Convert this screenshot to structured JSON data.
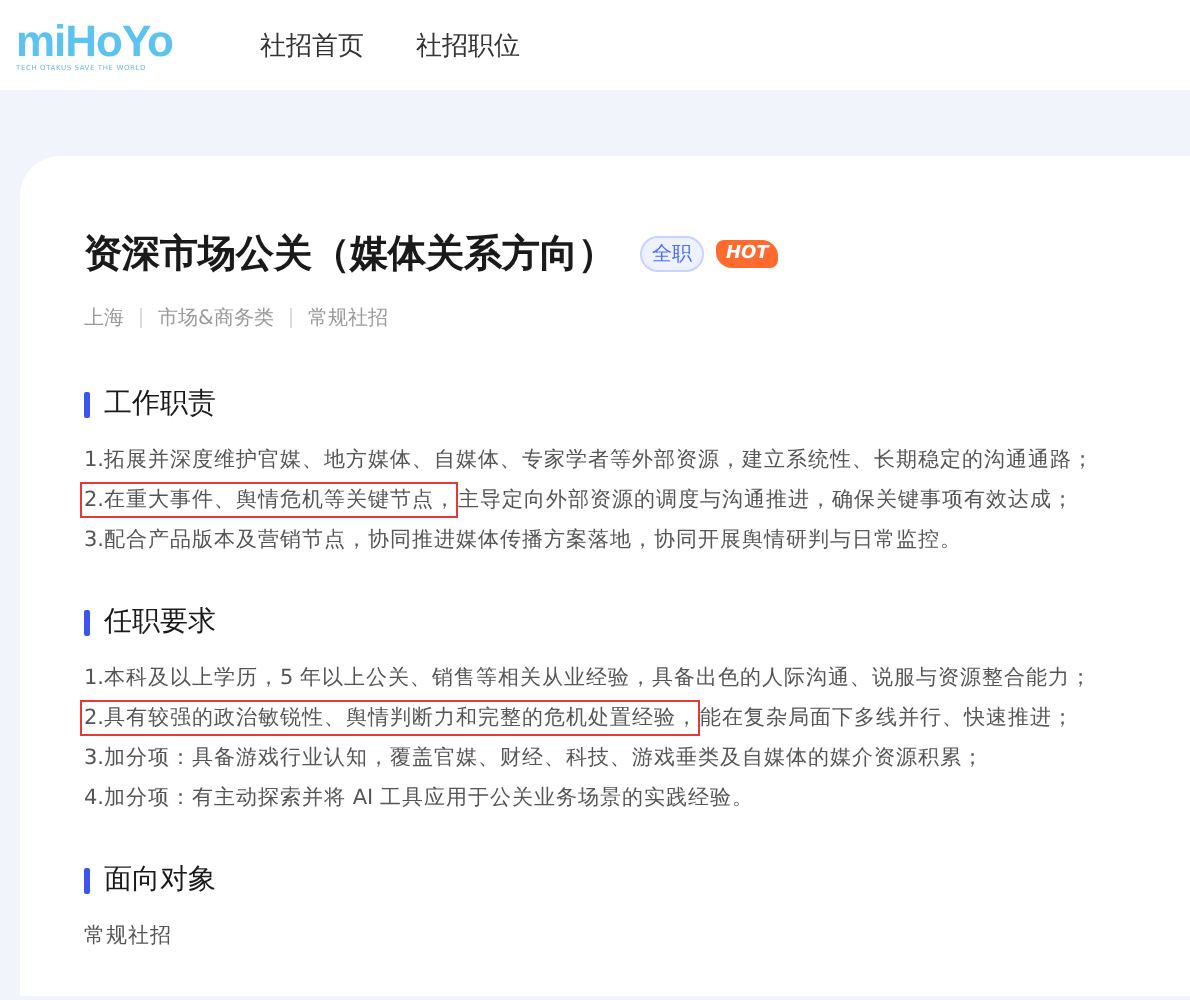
{
  "header": {
    "logo": {
      "wordmark": "miHoYo",
      "tagline": "TECH OTAKUS SAVE THE WORLD"
    },
    "nav": [
      {
        "label": "社招首页",
        "selected": false
      },
      {
        "label": "社招职位",
        "selected": false
      }
    ]
  },
  "job": {
    "title": "资深市场公关（媒体关系方向）",
    "tags": [
      {
        "label": "全职",
        "kind": "type"
      },
      {
        "label": "HOT",
        "kind": "hot"
      }
    ],
    "meta": [
      "上海",
      "市场&商务类",
      "常规社招"
    ]
  },
  "sections": [
    {
      "heading": "工作职责",
      "lines": [
        [
          {
            "text": "1.拓展并深度维护官媒、地方媒体、自媒体、专家学者等外部资源，建立系统性、长期稳定的沟通通路；",
            "highlighted": false
          }
        ],
        [
          {
            "text": "2.在重大事件、舆情危机等关键节点，",
            "highlighted": true
          },
          {
            "text": "主导定向外部资源的调度与沟通推进，确保关键事项有效达成；",
            "highlighted": false
          }
        ],
        [
          {
            "text": "3.配合产品版本及营销节点，协同推进媒体传播方案落地，协同开展舆情研判与日常监控。",
            "highlighted": false
          }
        ]
      ]
    },
    {
      "heading": "任职要求",
      "lines": [
        [
          {
            "text": "1.本科及以上学历，5 年以上公关、销售等相关从业经验，具备出色的人际沟通、说服与资源整合能力；",
            "highlighted": false
          }
        ],
        [
          {
            "text": "2.具有较强的政治敏锐性、舆情判断力和完整的危机处置经验，",
            "highlighted": true
          },
          {
            "text": "能在复杂局面下多线并行、快速推进；",
            "highlighted": false
          }
        ],
        [
          {
            "text": "3.加分项：具备游戏行业认知，覆盖官媒、财经、科技、游戏垂类及自媒体的媒介资源积累；",
            "highlighted": false
          }
        ],
        [
          {
            "text": "4.加分项：有主动探索并将 AI 工具应用于公关业务场景的实践经验。",
            "highlighted": false
          }
        ]
      ]
    },
    {
      "heading": "面向对象",
      "lines": [
        [
          {
            "text": "常规社招",
            "highlighted": false
          }
        ]
      ]
    }
  ]
}
